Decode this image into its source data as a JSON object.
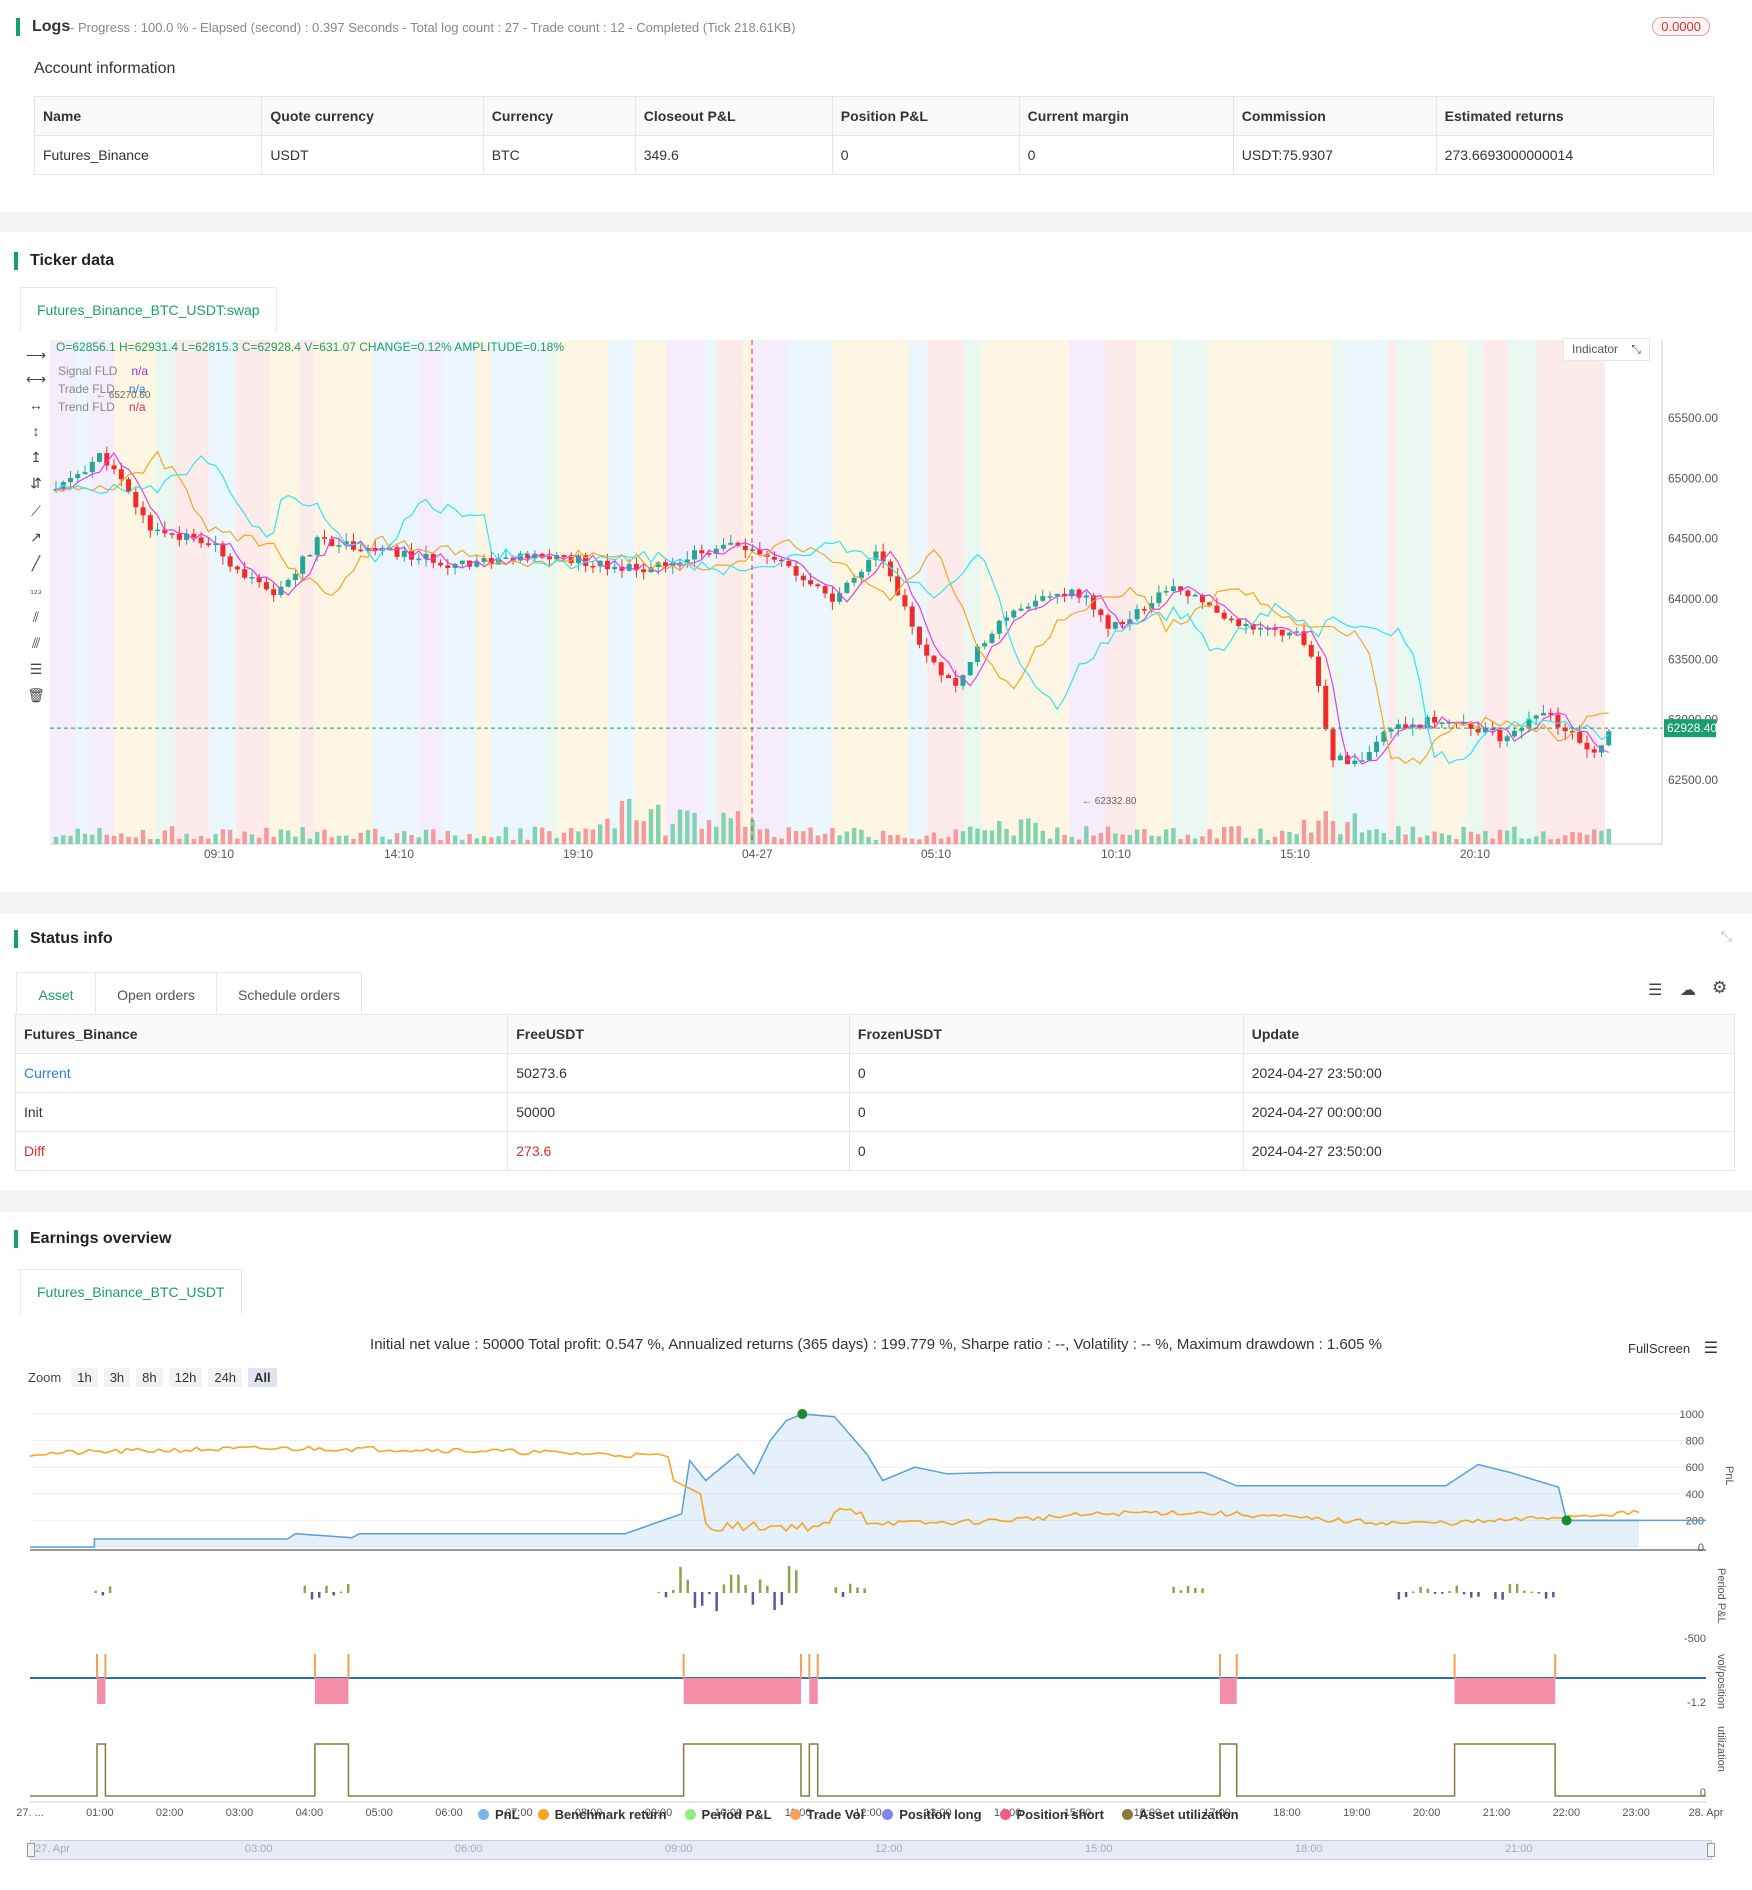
{
  "logs": {
    "title": "Logs",
    "status": "- Progress : 100.0 % - Elapsed (second) : 0.397  Seconds - Total log count : 27 - Trade count : 12 - Completed (Tick 218.61KB)",
    "badge": "0.0000"
  },
  "account": {
    "heading": "Account information",
    "columns": [
      "Name",
      "Quote currency",
      "Currency",
      "Closeout P&L",
      "Position P&L",
      "Current margin",
      "Commission",
      "Estimated returns"
    ],
    "row": [
      "Futures_Binance",
      "USDT",
      "BTC",
      "349.6",
      "0",
      "0",
      "USDT:75.9307",
      "273.6693000000014"
    ]
  },
  "ticker": {
    "heading": "Ticker data",
    "tab": "Futures_Binance_BTC_USDT:swap",
    "ohlc": "O=62856.1 H=62931.4 L=62815.3 C=62928.4 V=631.07 CHANGE=0.12% AMPLITUDE=0.18%",
    "indicator_btn": "Indicator",
    "legend": [
      {
        "name": "Signal FLD",
        "value": "n/a",
        "color": "#b02fd0"
      },
      {
        "name": "Trade FLD",
        "value": "n/a",
        "color": "#2a7fd4"
      },
      {
        "name": "Trend FLD",
        "value": "n/a",
        "color": "#d02f6a"
      }
    ],
    "y_ticks": [
      "65500.00",
      "65000.00",
      "64500.00",
      "64000.00",
      "63500.00",
      "63000.00",
      "62500.00"
    ],
    "x_ticks": [
      "09:10",
      "14:10",
      "19:10",
      "04-27",
      "05:10",
      "10:10",
      "15:10",
      "20:10"
    ],
    "last_price": "62928.40",
    "high_marker": "65270.60",
    "low_marker": "62332.80",
    "colors": {
      "up": "#26a69a",
      "down": "#ef2b2b",
      "fast": "#e040e8",
      "slow": "#f5a623",
      "cyan": "#2ee6f0"
    }
  },
  "status": {
    "heading": "Status info",
    "tabs": [
      "Asset",
      "Open orders",
      "Schedule orders"
    ],
    "columns": [
      "Futures_Binance",
      "FreeUSDT",
      "FrozenUSDT",
      "Update"
    ],
    "rows": [
      [
        "Current",
        "50273.6",
        "0",
        "2024-04-27 23:50:00"
      ],
      [
        "Init",
        "50000",
        "0",
        "2024-04-27 00:00:00"
      ],
      [
        "Diff",
        "273.6",
        "0",
        "2024-04-27 23:50:00"
      ]
    ]
  },
  "earnings": {
    "heading": "Earnings overview",
    "tab": "Futures_Binance_BTC_USDT",
    "summary": "Initial net value : 50000 Total profit: 0.547 %, Annualized returns (365 days) : 199.779 %, Sharpe ratio : --, Volatility : -- %, Maximum drawdown : 1.605 %",
    "fullscreen": "FullScreen",
    "zoom_label": "Zoom",
    "zoom_options": [
      "1h",
      "3h",
      "8h",
      "12h",
      "24h",
      "All"
    ],
    "pnl_ticks": [
      "1000",
      "800",
      "600",
      "400",
      "200",
      "0"
    ],
    "axis_names": [
      "PnL",
      "Period P&L",
      "vol/position",
      "utilization"
    ],
    "period_tick": "-500",
    "pos_tick": "-1.2",
    "util_tick": "0",
    "x_ticks": [
      "27. ...",
      "01:00",
      "02:00",
      "03:00",
      "04:00",
      "05:00",
      "06:00",
      "07:00",
      "08:00",
      "09:00",
      "10:00",
      "11:00",
      "12:00",
      "13:00",
      "14:00",
      "15:00",
      "16:00",
      "17:00",
      "18:00",
      "19:00",
      "20:00",
      "21:00",
      "22:00",
      "23:00",
      "28. Apr"
    ],
    "nav_ticks": [
      "27. Apr",
      "03:00",
      "06:00",
      "09:00",
      "12:00",
      "15:00",
      "18:00",
      "21:00"
    ],
    "legend": [
      {
        "name": "PnL",
        "color": "#7cb5ec"
      },
      {
        "name": "Benchmark return",
        "color": "#f5a623"
      },
      {
        "name": "Period P&L",
        "color": "#90ed7d"
      },
      {
        "name": "Trade Vol",
        "color": "#f7a35c"
      },
      {
        "name": "Position long",
        "color": "#8085e9"
      },
      {
        "name": "Position short",
        "color": "#f15c80"
      },
      {
        "name": "Asset utilization",
        "color": "#8d7a3a"
      }
    ]
  }
}
